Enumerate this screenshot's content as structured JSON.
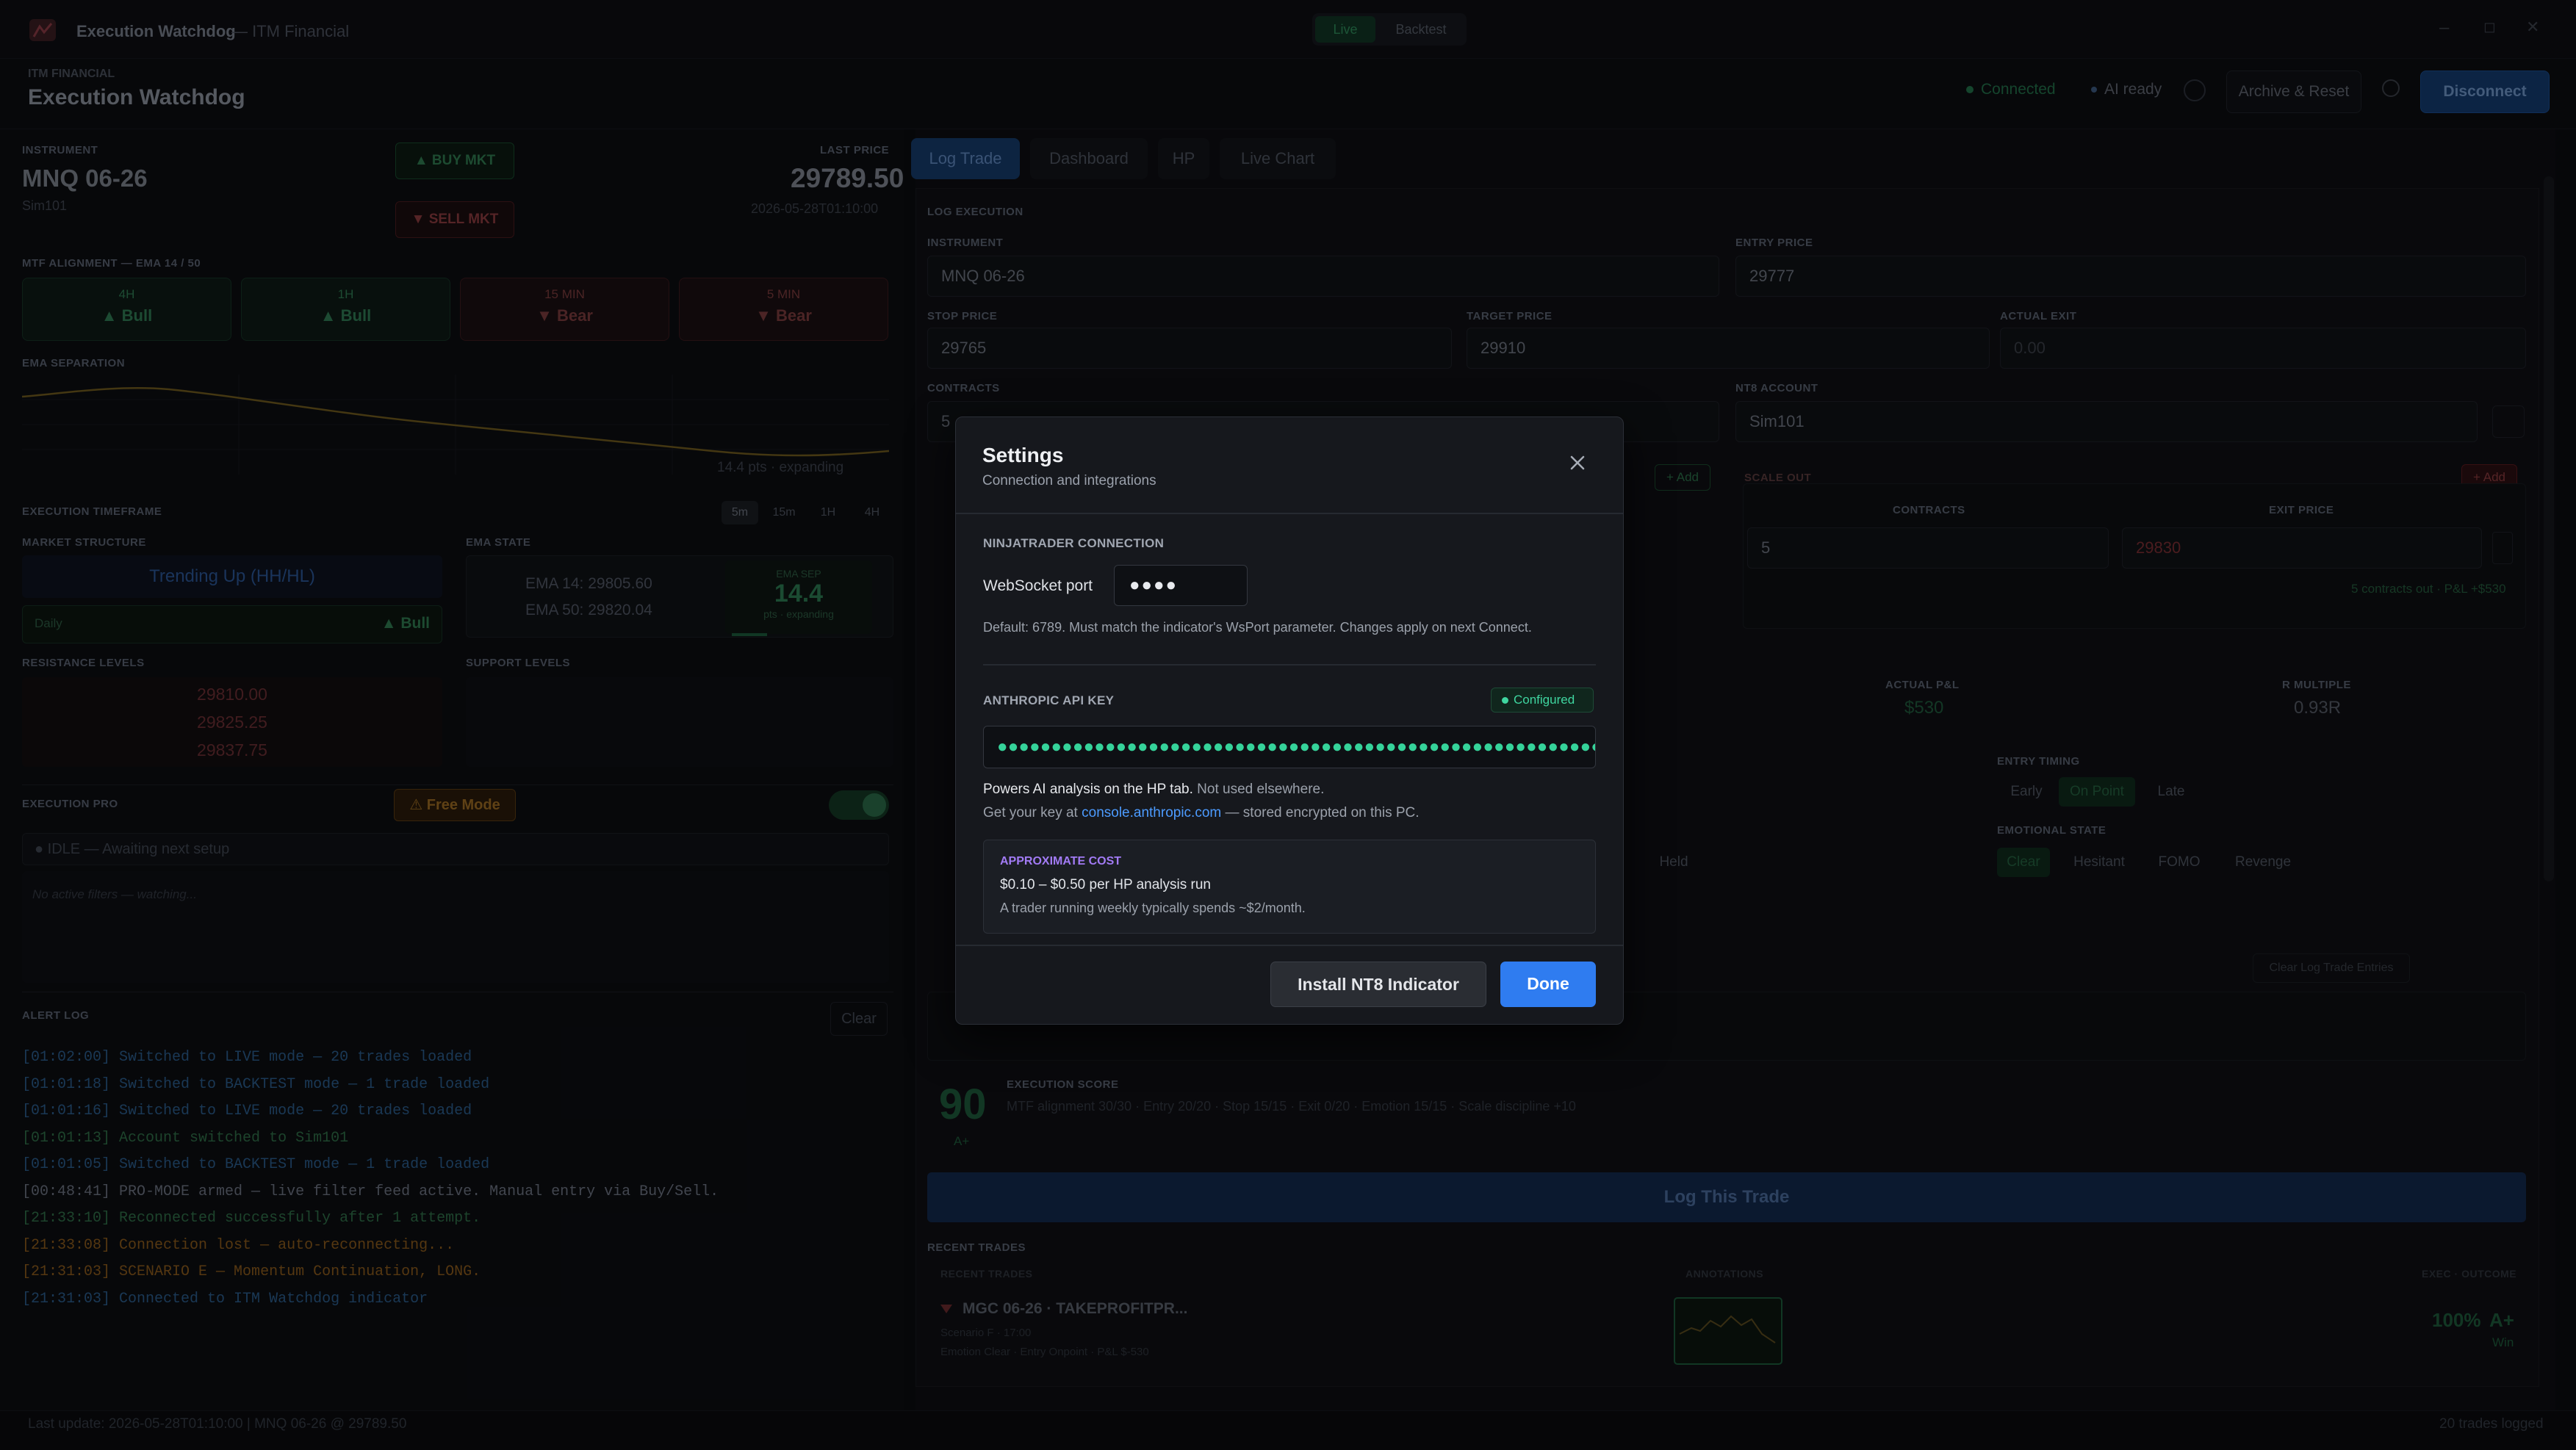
{
  "window": {
    "title": "Execution Watchdog",
    "subtitle": "— ITM Financial",
    "mode_live": "Live",
    "mode_backtest": "Backtest",
    "minimize": "–",
    "maximize": "◻",
    "close": "✕"
  },
  "header": {
    "brand_small": "ITM FINANCIAL",
    "brand": "Execution Watchdog",
    "connected": "Connected",
    "ai_ready": "AI ready",
    "archive": "Archive & Reset",
    "disconnect": "Disconnect"
  },
  "instrument": {
    "label": "INSTRUMENT",
    "name": "MNQ 06-26",
    "account": "Sim101",
    "buy": "▲ BUY MKT",
    "sell": "▼ SELL MKT",
    "last_price_label": "LAST PRICE",
    "last_price": "29789.50",
    "timestamp": "2026-05-28T01:10:00"
  },
  "mtf": {
    "label": "MTF ALIGNMENT — EMA 14 / 50",
    "boxes": [
      {
        "tf": "4H",
        "state": "▲ Bull",
        "kind": "bull"
      },
      {
        "tf": "1H",
        "state": "▲ Bull",
        "kind": "bull"
      },
      {
        "tf": "15 MIN",
        "state": "▼ Bear",
        "kind": "bear"
      },
      {
        "tf": "5 MIN",
        "state": "▼ Bear",
        "kind": "bear"
      }
    ]
  },
  "ema_sep": {
    "label": "EMA SEPARATION",
    "note": "14.4 pts · expanding"
  },
  "exec_tf": {
    "label": "EXECUTION TIMEFRAME",
    "options": [
      "5m",
      "15m",
      "1H",
      "4H"
    ]
  },
  "market": {
    "label": "MARKET STRUCTURE",
    "value": "Trending Up (HH/HL)",
    "bar_label": "Daily",
    "bar_value": "▲ Bull"
  },
  "ema_state": {
    "label": "EMA STATE",
    "ema14": "EMA 14:  29805.60",
    "ema50": "EMA 50:  29820.04",
    "sep_label": "EMA SEP",
    "sep_value": "14.4",
    "sep_note": "pts · expanding"
  },
  "resistance": {
    "label": "RESISTANCE LEVELS",
    "levels": [
      "29810.00",
      "29825.25",
      "29837.75"
    ]
  },
  "support": {
    "label": "SUPPORT LEVELS"
  },
  "pro": {
    "label": "EXECUTION PRO",
    "free_mode": "⚠ Free Mode",
    "idle": "● IDLE — Awaiting next setup",
    "no_filters": "No active filters — watching..."
  },
  "alerts": {
    "label": "ALERT LOG",
    "clear": "Clear",
    "lines": [
      {
        "t": "[01:02:00]",
        "m": "Switched to LIVE mode — 20 trades loaded",
        "c": "#2a5b8a"
      },
      {
        "t": "[01:01:18]",
        "m": "Switched to BACKTEST mode — 1 trade loaded",
        "c": "#2a5b8a"
      },
      {
        "t": "[01:01:16]",
        "m": "Switched to LIVE mode — 20 trades loaded",
        "c": "#2a5b8a"
      },
      {
        "t": "[01:01:13]",
        "m": "Account switched to Sim101",
        "c": "#2f6e48"
      },
      {
        "t": "[01:01:05]",
        "m": "Switched to BACKTEST mode — 1 trade loaded",
        "c": "#2a5b8a"
      },
      {
        "t": "[00:48:41]",
        "m": "PRO-MODE armed — live filter feed active. Manual entry via Buy/Sell.",
        "c": "#6b7280"
      },
      {
        "t": "[21:33:10]",
        "m": "Reconnected successfully after 1 attempt.",
        "c": "#2f6e48"
      },
      {
        "t": "[21:33:08]",
        "m": "Connection lost — auto-reconnecting...",
        "c": "#8a5a1c"
      },
      {
        "t": "[21:31:03]",
        "m": "SCENARIO E — Momentum Continuation, LONG.",
        "c": "#8a5a1c"
      },
      {
        "t": "[21:31:03]",
        "m": "Connected to ITM Watchdog indicator",
        "c": "#2a5b8a"
      }
    ]
  },
  "footer": {
    "left": "Last update: 2026-05-28T01:10:00 | MNQ 06-26 @ 29789.50",
    "right": "20 trades logged"
  },
  "tabs": [
    "Log Trade",
    "Dashboard",
    "HP",
    "Live Chart"
  ],
  "log": {
    "label": "LOG EXECUTION",
    "instrument_label": "INSTRUMENT",
    "instrument": "MNQ 06-26",
    "entry_label": "ENTRY PRICE",
    "entry": "29777",
    "stop_label": "STOP PRICE",
    "stop": "29765",
    "target_label": "TARGET PRICE",
    "target": "29910",
    "exit_label": "ACTUAL EXIT",
    "exit": "0.00",
    "contracts_label": "CONTRACTS",
    "contracts": "5",
    "account_label": "NT8 ACCOUNT",
    "account": "Sim101",
    "scale_in_add": "+ Add",
    "scale_out_label": "SCALE OUT",
    "scale_out_add": "+ Add",
    "so_contracts_label": "CONTRACTS",
    "so_contracts": "5",
    "so_exit_label": "EXIT PRICE",
    "so_exit": "29830",
    "so_note": "5 contracts out · P&L +$530",
    "pnl_label": "ACTUAL P&L",
    "pnl": "$530",
    "rm_label": "R MULTIPLE",
    "rm": "0.93R",
    "timing_label": "ENTRY TIMING",
    "timing": [
      "Early",
      "On Point",
      "Late"
    ],
    "emo_label": "EMOTIONAL STATE",
    "emo": [
      "Clear",
      "Hesitant",
      "FOMO",
      "Revenge"
    ],
    "held": "Held",
    "score_num": "90",
    "score_grade": "A+",
    "score_label": "EXECUTION SCORE",
    "score_detail": "MTF alignment 30/30  ·  Entry 20/20  ·  Stop 15/15  ·  Exit 0/20  ·  Emotion 15/15  ·  Scale discipline +10",
    "clear_form": "Clear Log Trade Entries",
    "log_btn": "Log This Trade"
  },
  "recent": {
    "label": "RECENT TRADES",
    "col1": "RECENT TRADES",
    "col2": "ANNOTATIONS",
    "col3": "EXEC · OUTCOME",
    "trade": "MGC 06-26  ·  TAKEPROFITPR...",
    "trade_sub1": "Scenario F  ·  17:00",
    "trade_sub2": "Emotion Clear  ·  Entry Onpoint  ·  P&L $-530",
    "pct": "100%",
    "grade": "A+",
    "outcome": "Win"
  },
  "modal": {
    "title": "Settings",
    "subtitle": "Connection and integrations",
    "nt_label": "NINJATRADER CONNECTION",
    "ws_label": "WebSocket port",
    "ws_value": "●●●●",
    "ws_help": "Default: 6789. Must match the indicator's WsPort parameter. Changes apply on next Connect.",
    "api_label": "ANTHROPIC API KEY",
    "api_badge": "Configured",
    "api_value": "●●●●●●●●●●●●●●●●●●●●●●●●●●●●●●●●●●●●●●●●●●●●●●●●●●●●●●●●●●",
    "api_help1_bold": "Powers AI analysis on the HP tab.",
    "api_help1_rest": "Not used elsewhere.",
    "api_help2_pre": "Get your key at",
    "api_help2_link": "console.anthropic.com",
    "api_help2_post": "— stored encrypted on this PC.",
    "cost_label": "APPROXIMATE COST",
    "cost_main": "$0.10 – $0.50 per HP analysis run",
    "cost_sub": "A trader running weekly typically spends ~$2/month.",
    "install_btn": "Install NT8 Indicator",
    "done_btn": "Done"
  },
  "colors": {
    "accent": "#2f7cf0",
    "green": "#3fd6a0",
    "purple": "#a27bf5",
    "link": "#4c9bff"
  }
}
